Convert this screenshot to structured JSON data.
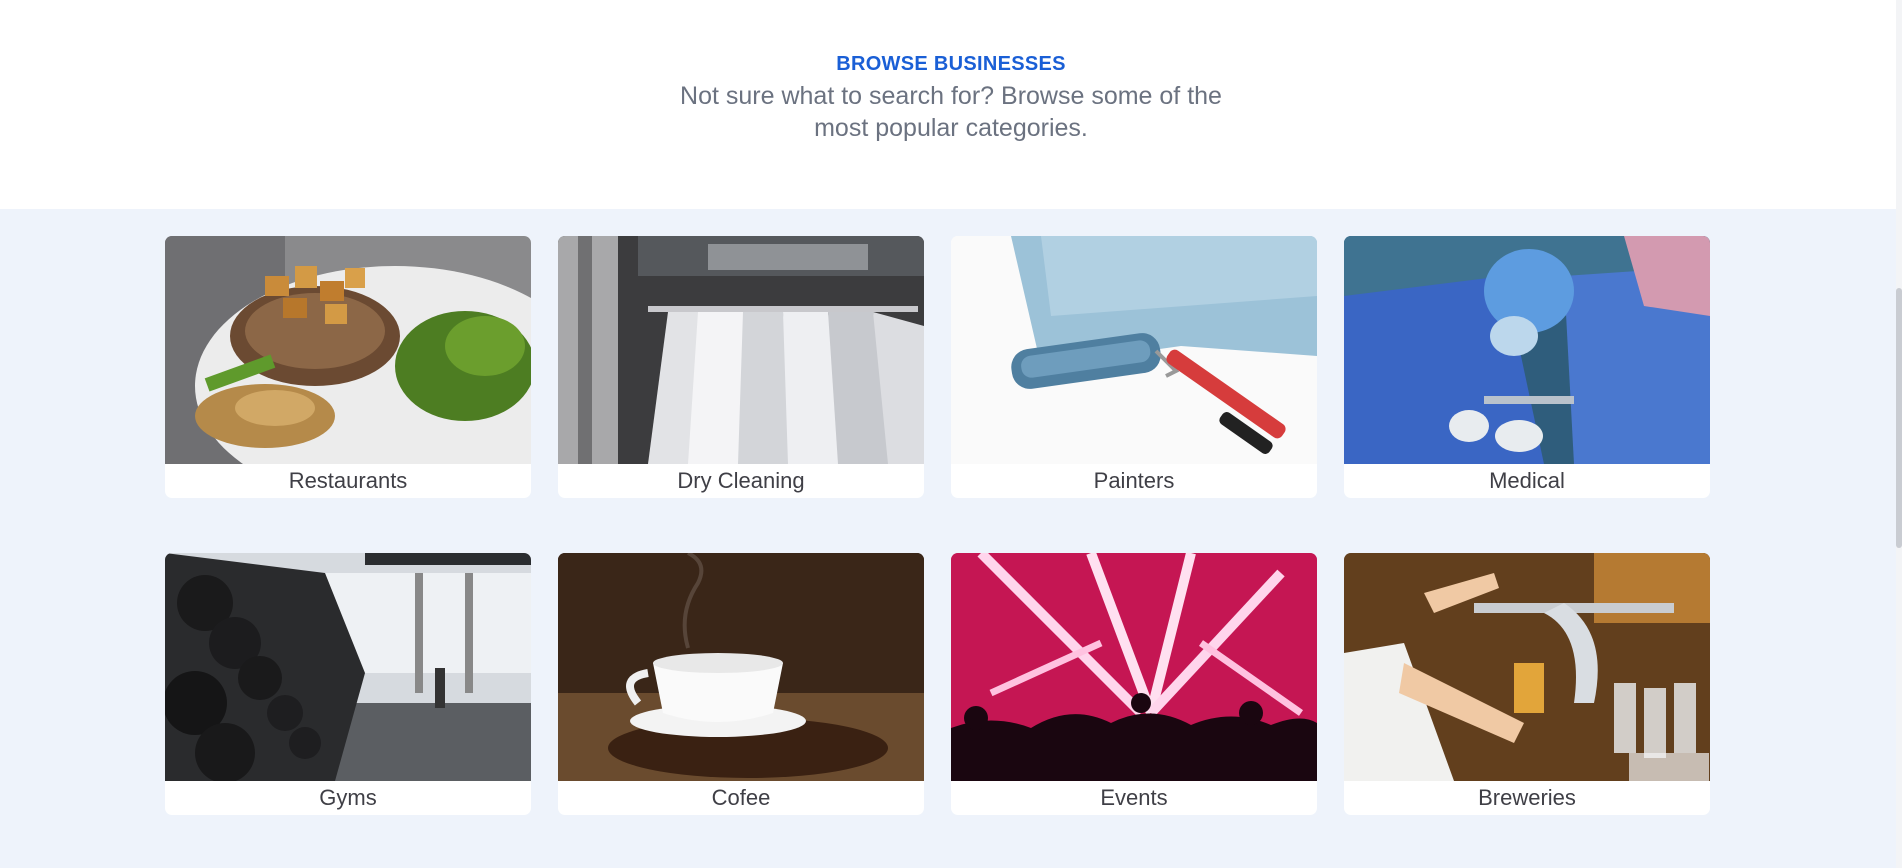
{
  "section": {
    "eyebrow": "BROWSE BUSINESSES",
    "subtitle": "Not sure what to search for? Browse some of the most popular categories."
  },
  "categories": [
    {
      "label": "Restaurants",
      "image": "grilled-pork-chop-photo"
    },
    {
      "label": "Dry Cleaning",
      "image": "dry-cleaning-garment-rack-photo"
    },
    {
      "label": "Painters",
      "image": "paint-roller-photo"
    },
    {
      "label": "Medical",
      "image": "surgeons-operating-photo"
    },
    {
      "label": "Gyms",
      "image": "gym-dumbbell-rack-photo"
    },
    {
      "label": "Cofee",
      "image": "coffee-cup-beans-photo"
    },
    {
      "label": "Events",
      "image": "concert-lights-crowd-photo"
    },
    {
      "label": "Breweries",
      "image": "bartender-beer-tap-photo"
    }
  ],
  "colors": {
    "accent": "#1a5fd6",
    "page_background": "#eef3fb",
    "card_background": "#ffffff",
    "subtitle_text": "#6b7280"
  }
}
